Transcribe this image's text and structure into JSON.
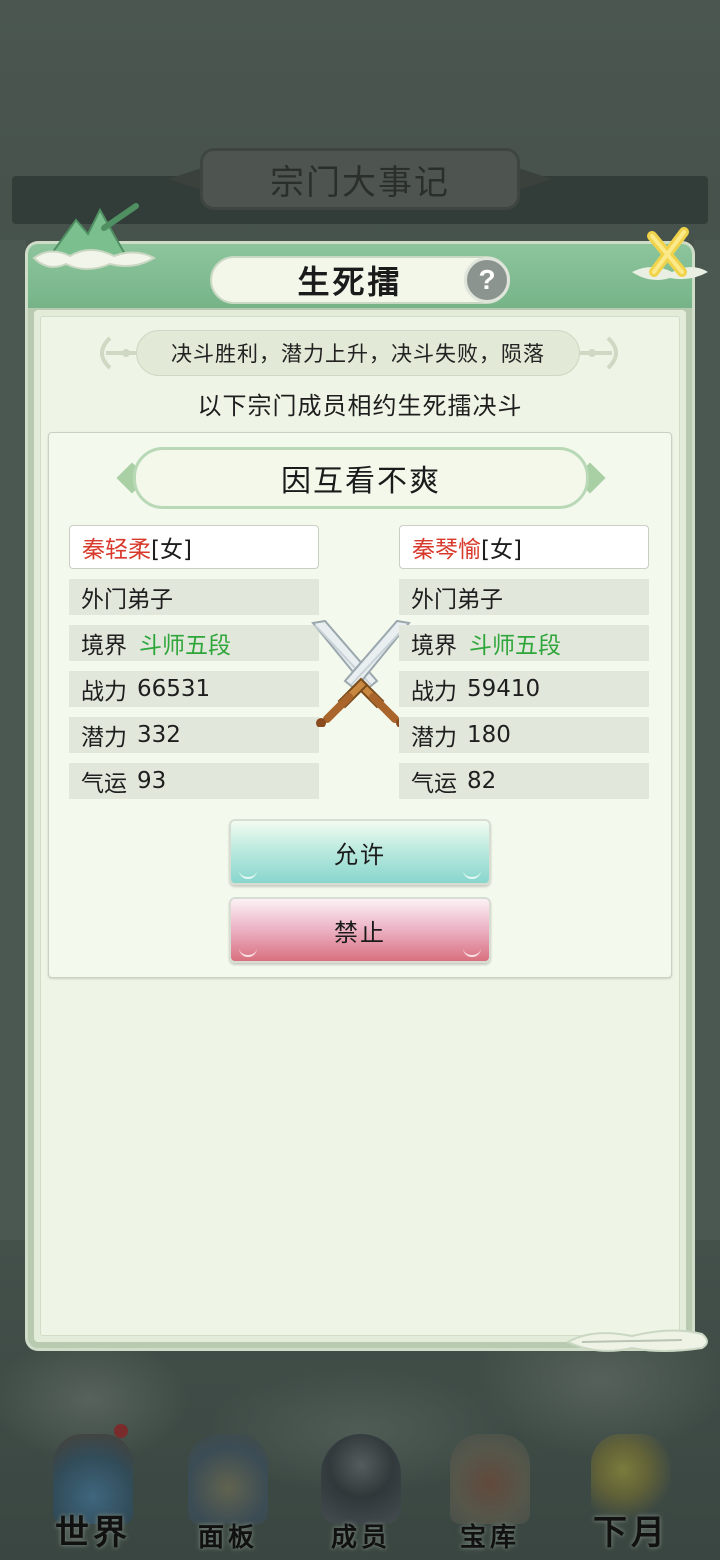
{
  "background": {
    "screen_title": "宗门大事记"
  },
  "dialog": {
    "title": "生死擂",
    "help_icon": "question-mark-icon",
    "close_icon": "close-x-icon",
    "rule": "决斗胜利，潜力上升，决斗失败，陨落",
    "description": "以下宗门成员相约生死擂决斗",
    "reason": "因互看不爽",
    "vs_icon": "crossed-swords-icon",
    "left": {
      "name": "秦轻柔",
      "gender": "[女]",
      "rank": "外门弟子",
      "realm_label": "境界",
      "realm_value": "斗师五段",
      "power_label": "战力",
      "power_value": "66531",
      "potential_label": "潜力",
      "potential_value": "332",
      "luck_label": "气运",
      "luck_value": "93"
    },
    "right": {
      "name": "秦琴愉",
      "gender": "[女]",
      "rank": "外门弟子",
      "realm_label": "境界",
      "realm_value": "斗师五段",
      "power_label": "战力",
      "power_value": "59410",
      "potential_label": "潜力",
      "potential_value": "180",
      "luck_label": "气运",
      "luck_value": "82"
    },
    "allow_label": "允许",
    "forbid_label": "禁止"
  },
  "bottom_nav": [
    {
      "label": "世界",
      "icon": "world-pavilion-icon"
    },
    {
      "label": "面板",
      "icon": "panel-gate-icon"
    },
    {
      "label": "成员",
      "icon": "member-figure-icon"
    },
    {
      "label": "宝库",
      "icon": "treasury-icon"
    },
    {
      "label": "下月",
      "icon": "crescent-moon-icon"
    }
  ],
  "colors": {
    "name_red": "#d8392a",
    "realm_green": "#2fa63a",
    "header_green": "#8dc59c",
    "allow_teal": "#88d6cd",
    "forbid_pink": "#d9707f"
  }
}
